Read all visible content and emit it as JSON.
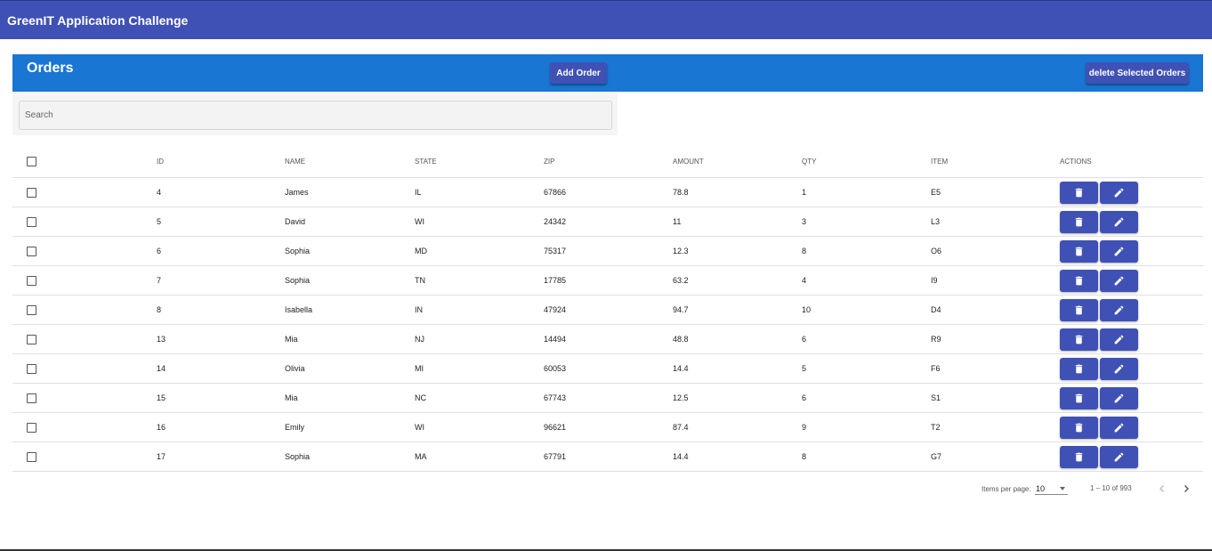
{
  "app": {
    "title": "GreenIT Application Challenge"
  },
  "orders": {
    "title": "Orders",
    "add_label": "Add Order",
    "delete_selected_label": "delete Selected Orders"
  },
  "search": {
    "placeholder": "Search",
    "value": ""
  },
  "table": {
    "columns": [
      "ID",
      "NAME",
      "STATE",
      "ZIP",
      "AMOUNT",
      "QTY",
      "ITEM",
      "ACTIONS"
    ],
    "rows": [
      {
        "id": "4",
        "name": "James",
        "state": "IL",
        "zip": "67866",
        "amount": "78.8",
        "qty": "1",
        "item": "E5"
      },
      {
        "id": "5",
        "name": "David",
        "state": "WI",
        "zip": "24342",
        "amount": "11",
        "qty": "3",
        "item": "L3"
      },
      {
        "id": "6",
        "name": "Sophia",
        "state": "MD",
        "zip": "75317",
        "amount": "12.3",
        "qty": "8",
        "item": "O6"
      },
      {
        "id": "7",
        "name": "Sophia",
        "state": "TN",
        "zip": "17785",
        "amount": "63.2",
        "qty": "4",
        "item": "I9"
      },
      {
        "id": "8",
        "name": "Isabella",
        "state": "IN",
        "zip": "47924",
        "amount": "94.7",
        "qty": "10",
        "item": "D4"
      },
      {
        "id": "13",
        "name": "Mia",
        "state": "NJ",
        "zip": "14494",
        "amount": "48.8",
        "qty": "6",
        "item": "R9"
      },
      {
        "id": "14",
        "name": "Olivia",
        "state": "MI",
        "zip": "60053",
        "amount": "14.4",
        "qty": "5",
        "item": "F6"
      },
      {
        "id": "15",
        "name": "Mia",
        "state": "NC",
        "zip": "67743",
        "amount": "12.5",
        "qty": "6",
        "item": "S1"
      },
      {
        "id": "16",
        "name": "Emily",
        "state": "WI",
        "zip": "96621",
        "amount": "87.4",
        "qty": "9",
        "item": "T2"
      },
      {
        "id": "17",
        "name": "Sophia",
        "state": "MA",
        "zip": "67791",
        "amount": "14.4",
        "qty": "8",
        "item": "G7"
      }
    ],
    "action_icons": [
      "trash-icon",
      "pencil-icon"
    ]
  },
  "paginator": {
    "items_per_page_label": "Items per page:",
    "page_size": "10",
    "range_label": "1 – 10 of 993"
  },
  "colors": {
    "app_bar": "#3f51b5",
    "orders_bar": "#1976d2",
    "button": "#3f51b5"
  }
}
